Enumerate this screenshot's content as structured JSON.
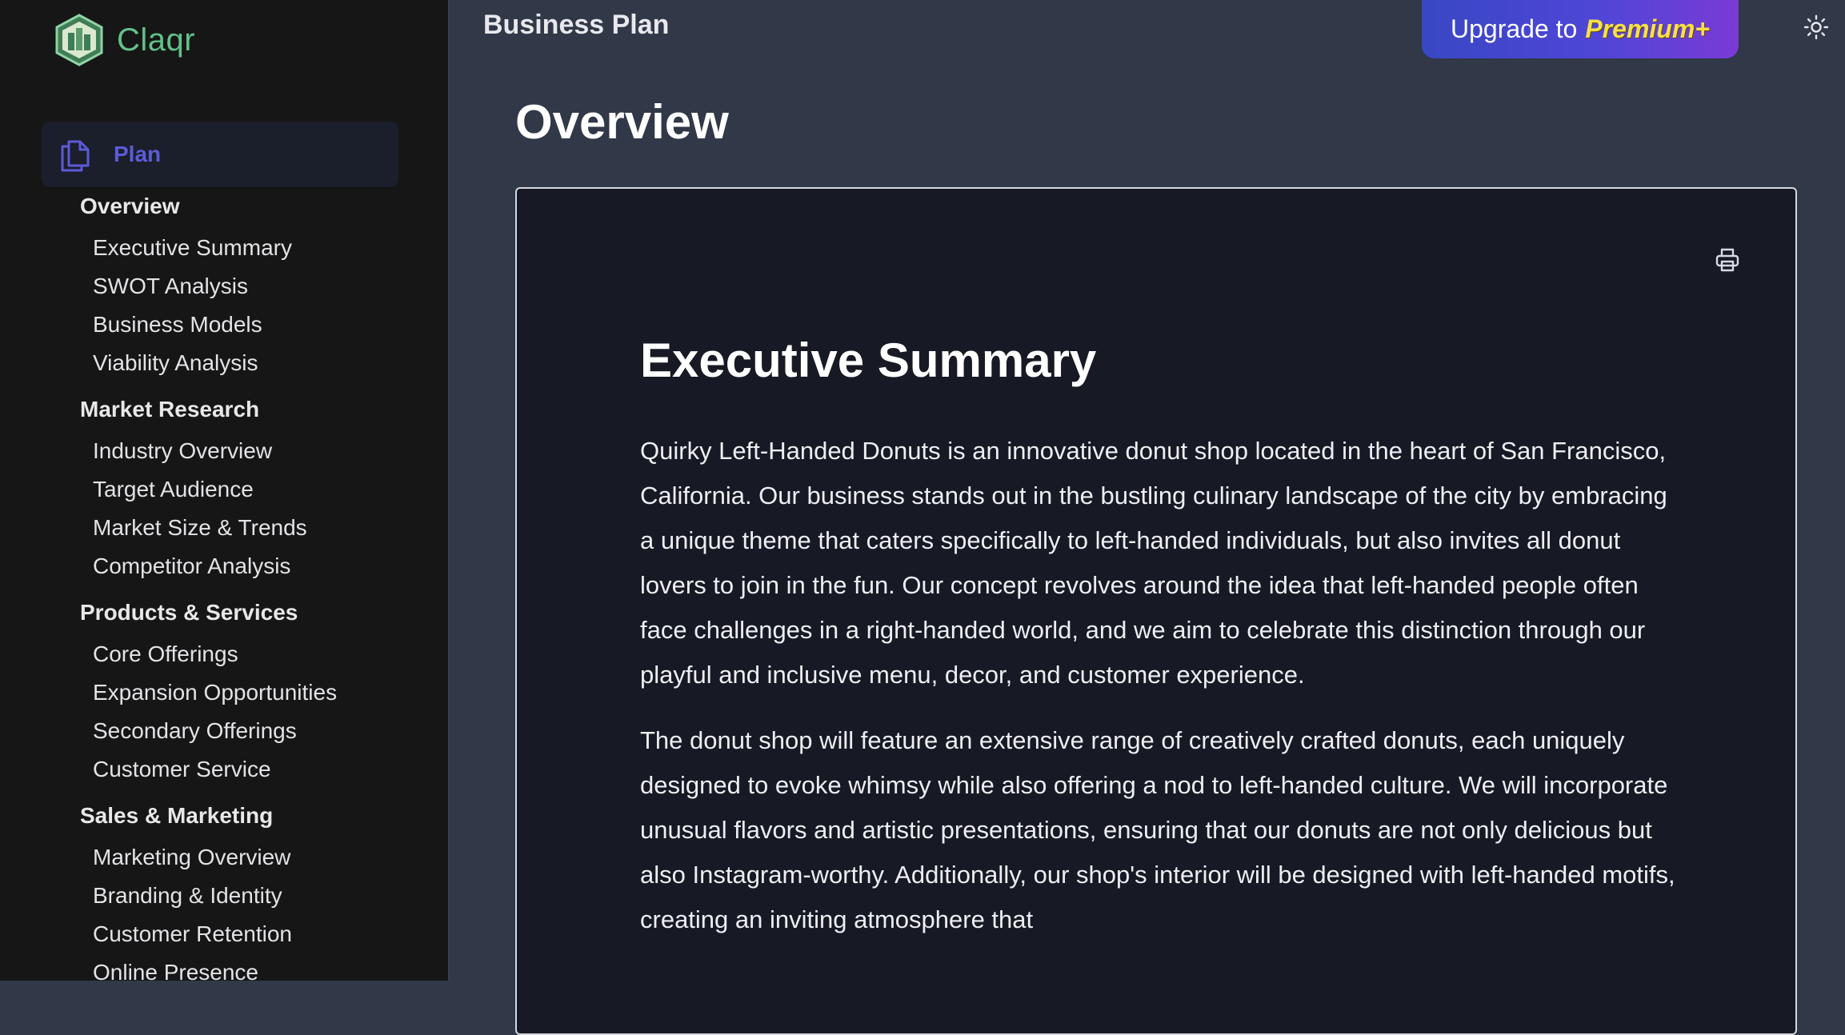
{
  "app": {
    "brand_name": "Claqr",
    "brand_color": "#63c08a",
    "accent_color": "#5b5bd6"
  },
  "sidebar": {
    "plan_label": "Plan",
    "plan_icon": "documents-icon",
    "groups": [
      {
        "heading": "Overview",
        "items": [
          "Executive Summary",
          "SWOT Analysis",
          "Business Models",
          "Viability Analysis"
        ]
      },
      {
        "heading": "Market Research",
        "items": [
          "Industry Overview",
          "Target Audience",
          "Market Size & Trends",
          "Competitor Analysis"
        ]
      },
      {
        "heading": "Products & Services",
        "items": [
          "Core Offerings",
          "Expansion Opportunities",
          "Secondary Offerings",
          "Customer Service"
        ]
      },
      {
        "heading": "Sales & Marketing",
        "items": [
          "Marketing Overview",
          "Branding & Identity",
          "Customer Retention",
          "Online Presence"
        ]
      }
    ]
  },
  "header": {
    "title": "Business Plan",
    "upgrade_prefix": "Upgrade to",
    "upgrade_highlight": "Premium+",
    "theme_icon": "sun-icon"
  },
  "main": {
    "page_title": "Overview",
    "print_icon": "printer-icon",
    "document": {
      "heading": "Executive Summary",
      "paragraphs": [
        "Quirky Left-Handed Donuts is an innovative donut shop located in the heart of San Francisco, California. Our business stands out in the bustling culinary landscape of the city by embracing a unique theme that caters specifically to left-handed individuals, but also invites all donut lovers to join in the fun. Our concept revolves around the idea that left-handed people often face challenges in a right-handed world, and we aim to celebrate this distinction through our playful and inclusive menu, decor, and customer experience.",
        "The donut shop will feature an extensive range of creatively crafted donuts, each uniquely designed to evoke whimsy while also offering a nod to left-handed culture. We will incorporate unusual flavors and artistic presentations, ensuring that our donuts are not only delicious but also Instagram-worthy. Additionally, our shop's interior will be designed with left-handed motifs, creating an inviting atmosphere that"
      ]
    }
  }
}
